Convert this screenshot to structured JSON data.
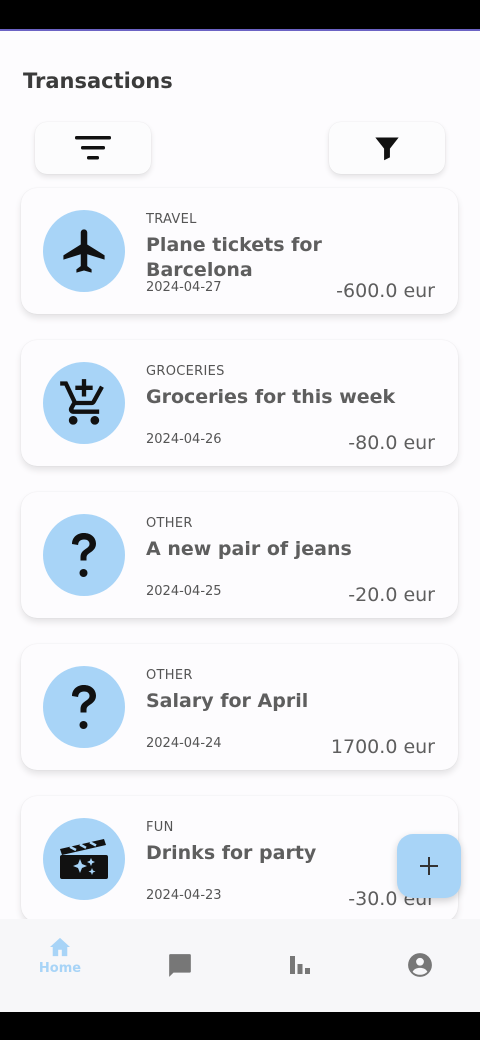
{
  "header": {
    "title": "Transactions"
  },
  "toolbar": {
    "sort_icon": "sort-icon",
    "filter_icon": "filter-icon"
  },
  "transactions": [
    {
      "category": "TRAVEL",
      "icon": "airplane-icon",
      "title": "Plane tickets for Barcelona",
      "date": "2024-04-27",
      "amount": "-600.0 eur"
    },
    {
      "category": "GROCERIES",
      "icon": "cart-add-icon",
      "title": "Groceries for this week",
      "date": "2024-04-26",
      "amount": "-80.0 eur"
    },
    {
      "category": "OTHER",
      "icon": "question-icon",
      "title": "A new pair of jeans",
      "date": "2024-04-25",
      "amount": "-20.0 eur"
    },
    {
      "category": "OTHER",
      "icon": "question-icon",
      "title": "Salary for April",
      "date": "2024-04-24",
      "amount": "1700.0 eur"
    },
    {
      "category": "FUN",
      "icon": "movie-icon",
      "title": "Drinks for party",
      "date": "2024-04-23",
      "amount": "-30.0 eur"
    }
  ],
  "fab": {
    "icon": "plus-icon"
  },
  "bottom_nav": {
    "items": [
      {
        "label": "Home",
        "icon": "home-icon",
        "active": true
      },
      {
        "label": "",
        "icon": "chat-icon",
        "active": false
      },
      {
        "label": "",
        "icon": "bar-chart-icon",
        "active": false
      },
      {
        "label": "",
        "icon": "account-icon",
        "active": false
      }
    ]
  },
  "colors": {
    "accent": "#a8d4f7",
    "background": "#fdfcfe",
    "text": "#5e5e5e"
  }
}
